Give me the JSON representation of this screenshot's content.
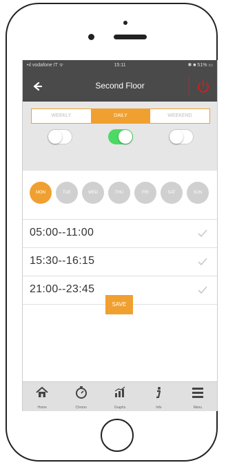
{
  "statusbar": {
    "carrier": "•ıl vodafone IT ᯤ",
    "time": "15:11",
    "right": "✱ ■ 51% ▭"
  },
  "header": {
    "title": "Second Floor"
  },
  "modes": {
    "tabs": [
      "WEEKLY",
      "DAILY",
      "WEEKEND"
    ],
    "active_index": 1,
    "toggles": [
      false,
      true,
      false
    ]
  },
  "days": {
    "labels": [
      "MON",
      "TUE",
      "WED",
      "THU",
      "FRI",
      "SAT",
      "SUN"
    ],
    "active_index": 0
  },
  "slots": [
    {
      "time": "05:00--11:00"
    },
    {
      "time": "15:30--16:15"
    },
    {
      "time": "21:00--23:45"
    }
  ],
  "save_label": "SAVE",
  "tabbar": {
    "items": [
      {
        "label": "Home",
        "icon": "home-icon"
      },
      {
        "label": "Chrono",
        "icon": "stopwatch-icon"
      },
      {
        "label": "Graphs",
        "icon": "chart-icon"
      },
      {
        "label": "Info",
        "icon": "info-icon"
      },
      {
        "label": "Menu",
        "icon": "menu-icon"
      }
    ]
  },
  "colors": {
    "accent": "#f0a030",
    "header": "#4a4a4a",
    "toggle_on": "#4cd964",
    "power": "#cc2020"
  }
}
